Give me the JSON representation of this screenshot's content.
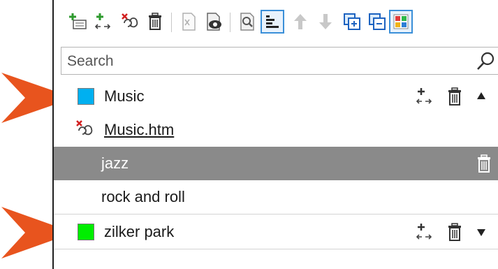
{
  "search": {
    "placeholder": "Search"
  },
  "toolbar": {
    "buttons": [
      {
        "icon": "add-category-icon"
      },
      {
        "icon": "add-link-icon"
      },
      {
        "icon": "remove-link-icon"
      },
      {
        "icon": "delete-icon"
      },
      {
        "icon": "document-icon"
      },
      {
        "icon": "preview-icon"
      },
      {
        "icon": "find-icon"
      },
      {
        "icon": "sort-icon"
      },
      {
        "icon": "move-up-icon"
      },
      {
        "icon": "move-down-icon"
      },
      {
        "icon": "expand-all-icon"
      },
      {
        "icon": "collapse-all-icon"
      },
      {
        "icon": "color-palette-icon"
      }
    ]
  },
  "tree": {
    "music": {
      "label": "Music",
      "color": "#00b0f0"
    },
    "music_link": {
      "label": "Music.htm"
    },
    "jazz": {
      "label": "jazz"
    },
    "rock": {
      "label": "rock and roll"
    },
    "zilker": {
      "label": "zilker park",
      "color": "#00ee00"
    }
  },
  "colors": {
    "arrow": "#e8541e",
    "selected_bg": "#8a8a8a",
    "link": "#1a5fc8"
  }
}
